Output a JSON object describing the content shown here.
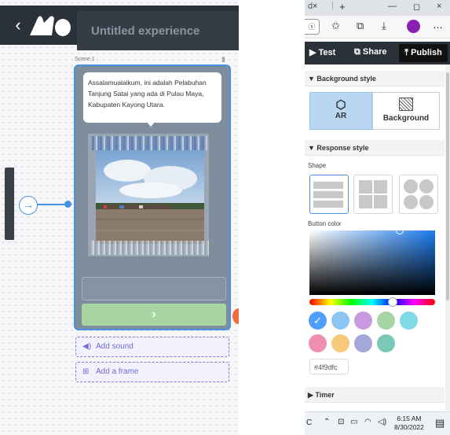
{
  "editor": {
    "title": "Untitled experience",
    "back_icon": "‹",
    "scene_label": "Scene 1",
    "start_icon": "→",
    "message": "Assalamualaikum, ini adalah Pelabuhan Tanjung Satai yang ada di Pulau Maya, Kabupaten Kayong Utara.",
    "next_icon": "›",
    "add_sound": "Add sound",
    "add_frame": "Add a frame"
  },
  "browser": {
    "tab_close": "×",
    "new_tab": "+",
    "minimize": "—",
    "restore": "◻",
    "close": "×",
    "menu": "…"
  },
  "actions": {
    "test": "Test",
    "share": "Share",
    "publish": "Publish"
  },
  "panel": {
    "background_style_header": "Background style",
    "background_options": [
      "AR",
      "Background"
    ],
    "response_style_header": "Response style",
    "shape_label": "Shape",
    "button_color_label": "Button color",
    "hex_value": "#4f9dfc",
    "timer_header": "Timer",
    "swatches": [
      "#4f9dfc",
      "#8ec5f0",
      "#c89ae0",
      "#a5d5a5",
      "#7fd9e6",
      "#f08fb0",
      "#f7c97a",
      "#a4a8d8",
      "#79c8b8"
    ]
  },
  "taskbar": {
    "time": "6:15 AM",
    "date": "8/30/2022"
  }
}
